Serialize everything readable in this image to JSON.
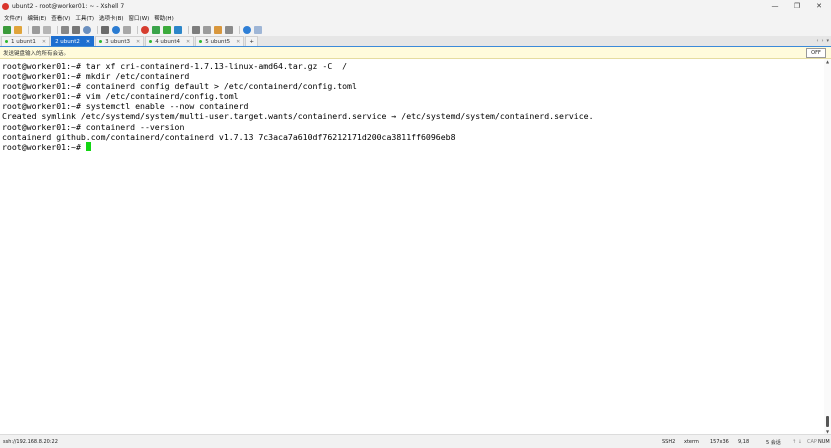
{
  "window": {
    "title": "ubunt2 - root@worker01: ~ - Xshell 7",
    "minimize": "—",
    "maximize": "❐",
    "close": "✕"
  },
  "menu": [
    "文件(F)",
    "编辑(E)",
    "查看(V)",
    "工具(T)",
    "选项卡(B)",
    "窗口(W)",
    "帮助(H)"
  ],
  "tabs": [
    {
      "label": "1 ubunt1",
      "active": false
    },
    {
      "label": "2 ubunt2",
      "active": true
    },
    {
      "label": "3 ubunt3",
      "active": false
    },
    {
      "label": "4 ubunt4",
      "active": false
    },
    {
      "label": "5 ubunt5",
      "active": false
    }
  ],
  "tabs_add": "+",
  "broadcast": {
    "text": "发送键盘输入的所有会话。",
    "toggle": "OFF"
  },
  "terminal": {
    "lines": [
      "root@worker01:~# tar xf cri-containerd-1.7.13-linux-amd64.tar.gz -C  /",
      "root@worker01:~# mkdir /etc/containerd",
      "root@worker01:~# containerd config default > /etc/containerd/config.toml",
      "root@worker01:~# vim /etc/containerd/config.toml",
      "root@worker01:~# systemctl enable --now containerd",
      "Created symlink /etc/systemd/system/multi-user.target.wants/containerd.service → /etc/systemd/system/containerd.service.",
      "root@worker01:~# containerd --version",
      "containerd github.com/containerd/containerd v1.7.13 7c3aca7a610df76212171d200ca3811ff6096eb8",
      "root@worker01:~# "
    ]
  },
  "status": {
    "host": "ssh://192.168.8.20:22",
    "protocol": "SSH2",
    "term": "xterm",
    "size": "157x36",
    "pos": "9,18",
    "sessions": "5 会话",
    "caps": "CAP",
    "num": "NUM"
  },
  "colors": {
    "accent": "#1e6fd0",
    "cursor": "#13d613",
    "broadcast_bg": "#fffbdc"
  }
}
